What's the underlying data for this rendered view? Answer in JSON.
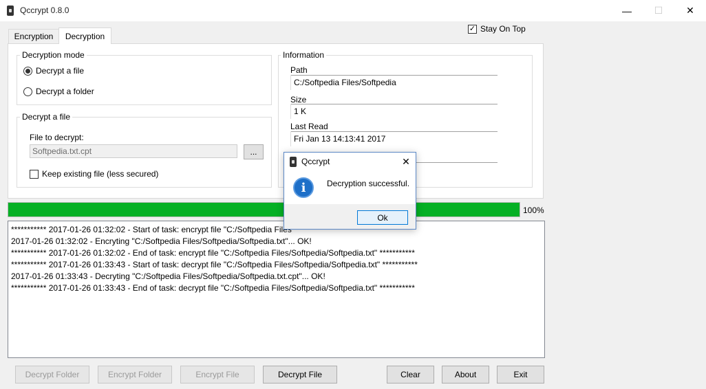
{
  "window": {
    "title": "Qccrypt 0.8.0",
    "minimize": "—",
    "maximize": "☐",
    "close": "✕"
  },
  "stay_on_top": {
    "label": "Stay On Top",
    "checked": true,
    "mark": "✓"
  },
  "tabs": [
    {
      "label": "Encryption",
      "active": false
    },
    {
      "label": "Decryption",
      "active": true
    }
  ],
  "decryption_mode": {
    "legend": "Decryption mode",
    "options": [
      {
        "label": "Decrypt a file",
        "selected": true
      },
      {
        "label": "Decrypt a folder",
        "selected": false
      }
    ]
  },
  "decrypt_file": {
    "legend": "Decrypt a file",
    "file_label": "File to decrypt:",
    "file_value": "Softpedia.txt.cpt",
    "browse_label": "...",
    "keep_label": "Keep existing file (less secured)",
    "keep_checked": false
  },
  "information": {
    "legend": "Information",
    "path_label": "Path",
    "path_value": "C:/Softpedia Files/Softpedia",
    "size_label": "Size",
    "size_value": "1 K",
    "last_read_label": "Last Read",
    "last_read_value": "Fri Jan 13 14:13:41 2017"
  },
  "progress": {
    "percent": 100,
    "label": "100%"
  },
  "log": [
    "*********** 2017-01-26 01:32:02 - Start of task: encrypt file \"C:/Softpedia Files",
    "2017-01-26 01:32:02 - Encryting \"C:/Softpedia Files/Softpedia/Softpedia.txt\"... OK!",
    "*********** 2017-01-26 01:32:02 - End of task: encrypt file \"C:/Softpedia Files/Softpedia/Softpedia.txt\" ***********",
    "*********** 2017-01-26 01:33:43 - Start of task: decrypt file \"C:/Softpedia Files/Softpedia/Softpedia.txt\" ***********",
    "2017-01-26 01:33:43 - Decryting \"C:/Softpedia Files/Softpedia/Softpedia.txt.cpt\"... OK!",
    "*********** 2017-01-26 01:33:43 - End of task: decrypt file \"C:/Softpedia Files/Softpedia/Softpedia.txt\" ***********"
  ],
  "buttons": {
    "decrypt_folder": "Decrypt Folder",
    "encrypt_folder": "Encrypt Folder",
    "encrypt_file": "Encrypt File",
    "decrypt_file": "Decrypt File",
    "clear": "Clear",
    "about": "About",
    "exit": "Exit"
  },
  "dialog": {
    "title": "Qccrypt",
    "close": "✕",
    "icon": "information-icon",
    "icon_glyph": "i",
    "message": "Decryption successful.",
    "ok_label": "Ok"
  },
  "colors": {
    "progress_fill": "#06b025",
    "info_icon": "#1d6fc8",
    "dialog_border": "#5b87c5"
  }
}
